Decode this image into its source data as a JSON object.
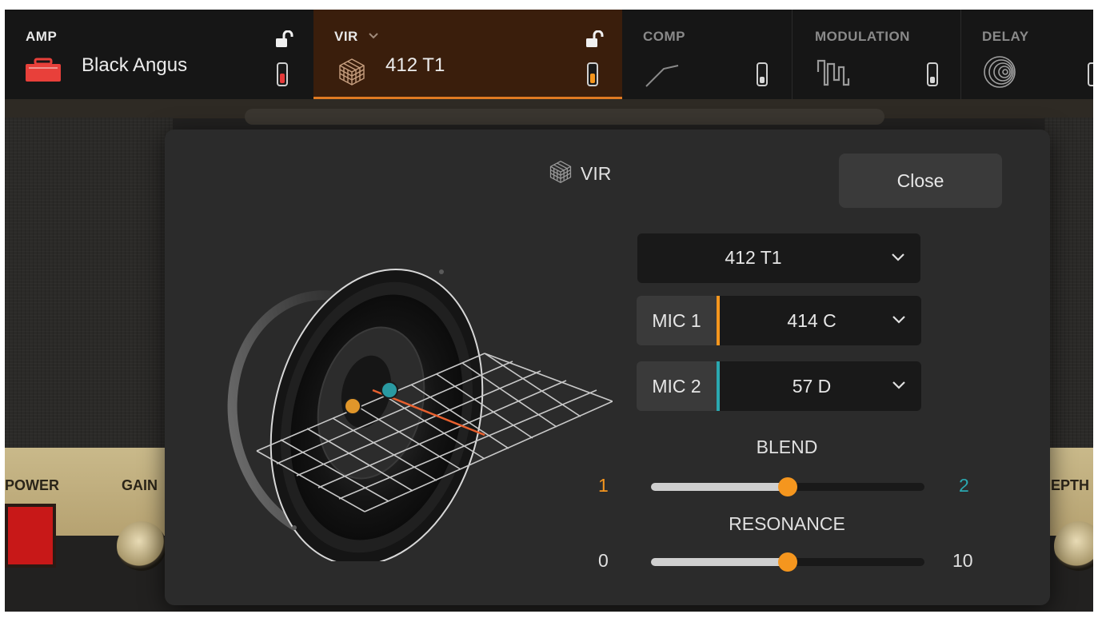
{
  "topbar": {
    "amp": {
      "label": "AMP",
      "name": "Black Angus",
      "toggle_color": "#e63a3a"
    },
    "vir": {
      "label": "VIR",
      "name": "412 T1",
      "toggle_color": "#f5961e",
      "accent": "#e07a22"
    },
    "comp": {
      "label": "COMP"
    },
    "modulation": {
      "label": "MODULATION"
    },
    "delay": {
      "label": "DELAY"
    }
  },
  "amp_panel": {
    "power_label": "POWER",
    "gain_label": "GAIN",
    "depth_label": "EPTH"
  },
  "dialog": {
    "title": "VIR",
    "close_label": "Close",
    "cabinet": {
      "value": "412 T1"
    },
    "mic1": {
      "label": "MIC 1",
      "value": "414 C",
      "color": "#f5961e"
    },
    "mic2": {
      "label": "MIC 2",
      "value": "57 D",
      "color": "#2aa8b0"
    },
    "blend": {
      "label": "BLEND",
      "min_label": "1",
      "max_label": "2",
      "level": 0.5
    },
    "resonance": {
      "label": "RESONANCE",
      "min_label": "0",
      "max_label": "10",
      "level": 0.5
    }
  },
  "icons": {
    "amp": "amp-icon",
    "vir": "cube-icon",
    "comp": "compressor-curve-icon",
    "modulation": "waveform-icon",
    "delay": "delay-rings-icon",
    "lock": "unlock-icon",
    "chevron": "chevron-down-icon"
  }
}
